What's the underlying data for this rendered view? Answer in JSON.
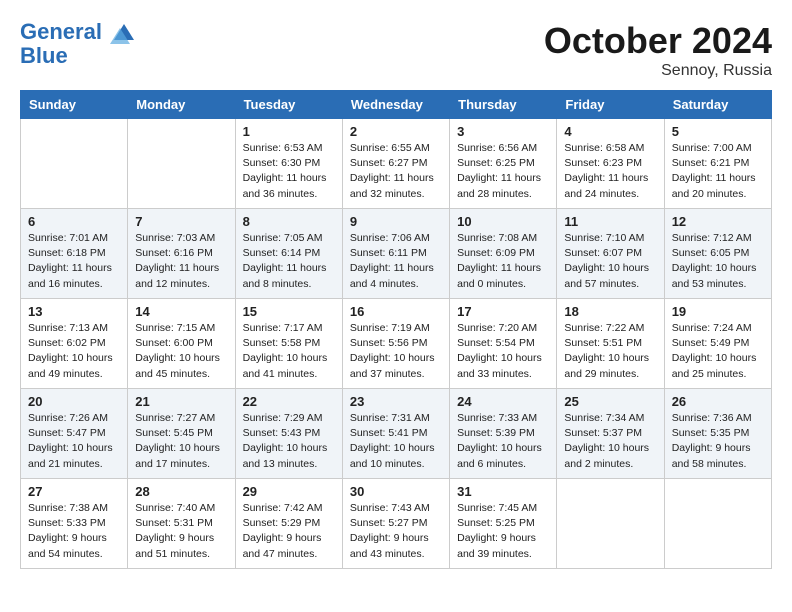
{
  "header": {
    "logo_line1": "General",
    "logo_line2": "Blue",
    "month_title": "October 2024",
    "location": "Sennoy, Russia"
  },
  "weekdays": [
    "Sunday",
    "Monday",
    "Tuesday",
    "Wednesday",
    "Thursday",
    "Friday",
    "Saturday"
  ],
  "weeks": [
    [
      {
        "day": "",
        "sunrise": "",
        "sunset": "",
        "daylight": ""
      },
      {
        "day": "",
        "sunrise": "",
        "sunset": "",
        "daylight": ""
      },
      {
        "day": "1",
        "sunrise": "Sunrise: 6:53 AM",
        "sunset": "Sunset: 6:30 PM",
        "daylight": "Daylight: 11 hours and 36 minutes."
      },
      {
        "day": "2",
        "sunrise": "Sunrise: 6:55 AM",
        "sunset": "Sunset: 6:27 PM",
        "daylight": "Daylight: 11 hours and 32 minutes."
      },
      {
        "day": "3",
        "sunrise": "Sunrise: 6:56 AM",
        "sunset": "Sunset: 6:25 PM",
        "daylight": "Daylight: 11 hours and 28 minutes."
      },
      {
        "day": "4",
        "sunrise": "Sunrise: 6:58 AM",
        "sunset": "Sunset: 6:23 PM",
        "daylight": "Daylight: 11 hours and 24 minutes."
      },
      {
        "day": "5",
        "sunrise": "Sunrise: 7:00 AM",
        "sunset": "Sunset: 6:21 PM",
        "daylight": "Daylight: 11 hours and 20 minutes."
      }
    ],
    [
      {
        "day": "6",
        "sunrise": "Sunrise: 7:01 AM",
        "sunset": "Sunset: 6:18 PM",
        "daylight": "Daylight: 11 hours and 16 minutes."
      },
      {
        "day": "7",
        "sunrise": "Sunrise: 7:03 AM",
        "sunset": "Sunset: 6:16 PM",
        "daylight": "Daylight: 11 hours and 12 minutes."
      },
      {
        "day": "8",
        "sunrise": "Sunrise: 7:05 AM",
        "sunset": "Sunset: 6:14 PM",
        "daylight": "Daylight: 11 hours and 8 minutes."
      },
      {
        "day": "9",
        "sunrise": "Sunrise: 7:06 AM",
        "sunset": "Sunset: 6:11 PM",
        "daylight": "Daylight: 11 hours and 4 minutes."
      },
      {
        "day": "10",
        "sunrise": "Sunrise: 7:08 AM",
        "sunset": "Sunset: 6:09 PM",
        "daylight": "Daylight: 11 hours and 0 minutes."
      },
      {
        "day": "11",
        "sunrise": "Sunrise: 7:10 AM",
        "sunset": "Sunset: 6:07 PM",
        "daylight": "Daylight: 10 hours and 57 minutes."
      },
      {
        "day": "12",
        "sunrise": "Sunrise: 7:12 AM",
        "sunset": "Sunset: 6:05 PM",
        "daylight": "Daylight: 10 hours and 53 minutes."
      }
    ],
    [
      {
        "day": "13",
        "sunrise": "Sunrise: 7:13 AM",
        "sunset": "Sunset: 6:02 PM",
        "daylight": "Daylight: 10 hours and 49 minutes."
      },
      {
        "day": "14",
        "sunrise": "Sunrise: 7:15 AM",
        "sunset": "Sunset: 6:00 PM",
        "daylight": "Daylight: 10 hours and 45 minutes."
      },
      {
        "day": "15",
        "sunrise": "Sunrise: 7:17 AM",
        "sunset": "Sunset: 5:58 PM",
        "daylight": "Daylight: 10 hours and 41 minutes."
      },
      {
        "day": "16",
        "sunrise": "Sunrise: 7:19 AM",
        "sunset": "Sunset: 5:56 PM",
        "daylight": "Daylight: 10 hours and 37 minutes."
      },
      {
        "day": "17",
        "sunrise": "Sunrise: 7:20 AM",
        "sunset": "Sunset: 5:54 PM",
        "daylight": "Daylight: 10 hours and 33 minutes."
      },
      {
        "day": "18",
        "sunrise": "Sunrise: 7:22 AM",
        "sunset": "Sunset: 5:51 PM",
        "daylight": "Daylight: 10 hours and 29 minutes."
      },
      {
        "day": "19",
        "sunrise": "Sunrise: 7:24 AM",
        "sunset": "Sunset: 5:49 PM",
        "daylight": "Daylight: 10 hours and 25 minutes."
      }
    ],
    [
      {
        "day": "20",
        "sunrise": "Sunrise: 7:26 AM",
        "sunset": "Sunset: 5:47 PM",
        "daylight": "Daylight: 10 hours and 21 minutes."
      },
      {
        "day": "21",
        "sunrise": "Sunrise: 7:27 AM",
        "sunset": "Sunset: 5:45 PM",
        "daylight": "Daylight: 10 hours and 17 minutes."
      },
      {
        "day": "22",
        "sunrise": "Sunrise: 7:29 AM",
        "sunset": "Sunset: 5:43 PM",
        "daylight": "Daylight: 10 hours and 13 minutes."
      },
      {
        "day": "23",
        "sunrise": "Sunrise: 7:31 AM",
        "sunset": "Sunset: 5:41 PM",
        "daylight": "Daylight: 10 hours and 10 minutes."
      },
      {
        "day": "24",
        "sunrise": "Sunrise: 7:33 AM",
        "sunset": "Sunset: 5:39 PM",
        "daylight": "Daylight: 10 hours and 6 minutes."
      },
      {
        "day": "25",
        "sunrise": "Sunrise: 7:34 AM",
        "sunset": "Sunset: 5:37 PM",
        "daylight": "Daylight: 10 hours and 2 minutes."
      },
      {
        "day": "26",
        "sunrise": "Sunrise: 7:36 AM",
        "sunset": "Sunset: 5:35 PM",
        "daylight": "Daylight: 9 hours and 58 minutes."
      }
    ],
    [
      {
        "day": "27",
        "sunrise": "Sunrise: 7:38 AM",
        "sunset": "Sunset: 5:33 PM",
        "daylight": "Daylight: 9 hours and 54 minutes."
      },
      {
        "day": "28",
        "sunrise": "Sunrise: 7:40 AM",
        "sunset": "Sunset: 5:31 PM",
        "daylight": "Daylight: 9 hours and 51 minutes."
      },
      {
        "day": "29",
        "sunrise": "Sunrise: 7:42 AM",
        "sunset": "Sunset: 5:29 PM",
        "daylight": "Daylight: 9 hours and 47 minutes."
      },
      {
        "day": "30",
        "sunrise": "Sunrise: 7:43 AM",
        "sunset": "Sunset: 5:27 PM",
        "daylight": "Daylight: 9 hours and 43 minutes."
      },
      {
        "day": "31",
        "sunrise": "Sunrise: 7:45 AM",
        "sunset": "Sunset: 5:25 PM",
        "daylight": "Daylight: 9 hours and 39 minutes."
      },
      {
        "day": "",
        "sunrise": "",
        "sunset": "",
        "daylight": ""
      },
      {
        "day": "",
        "sunrise": "",
        "sunset": "",
        "daylight": ""
      }
    ]
  ]
}
